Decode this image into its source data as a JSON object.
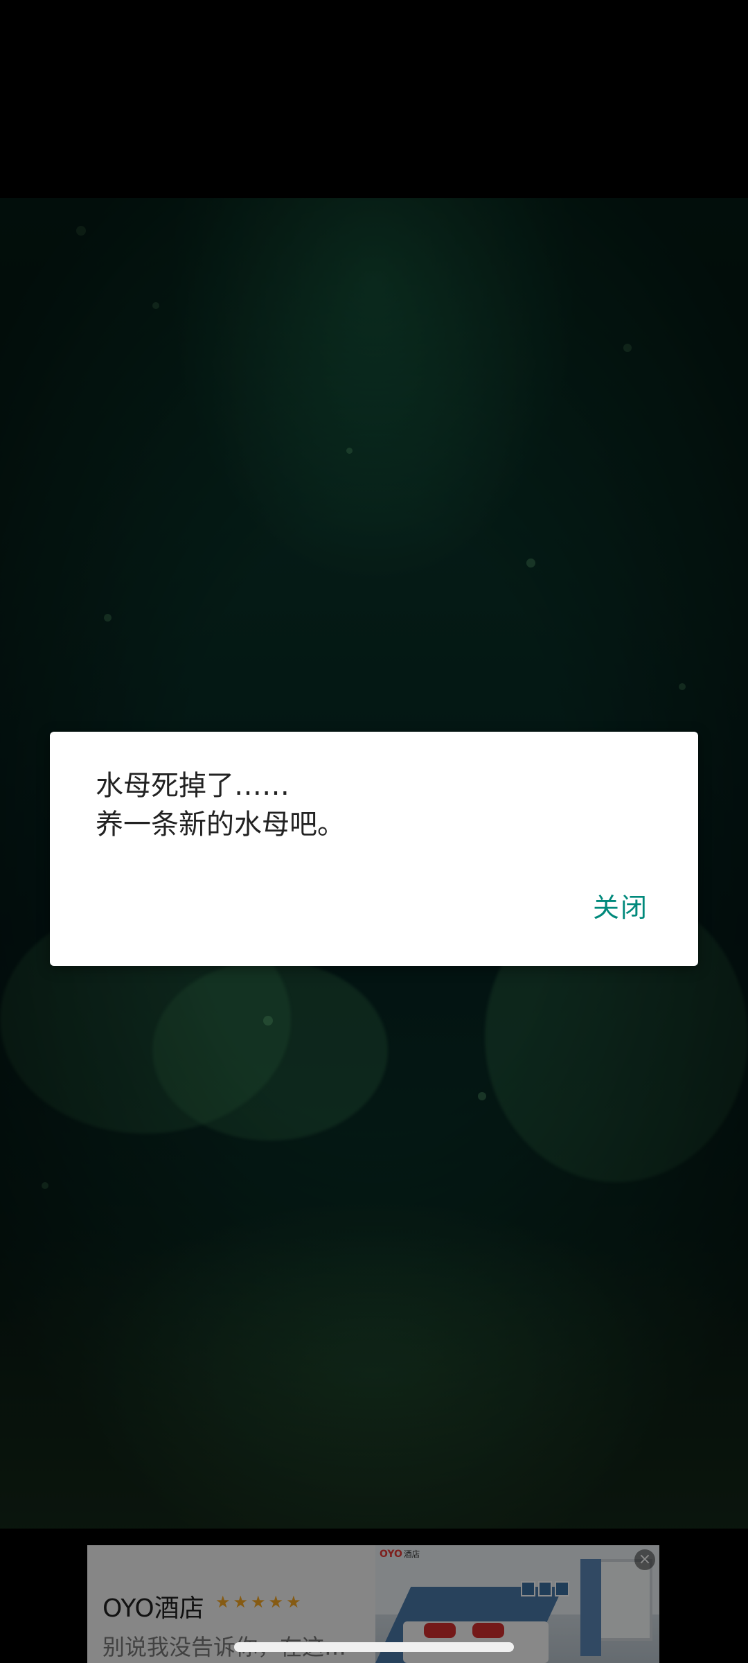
{
  "dialog": {
    "line1": "水母死掉了……",
    "line2": "养一条新的水母吧。",
    "close_label": "关闭"
  },
  "ad": {
    "title": "OYO酒店",
    "stars": "★★★★★",
    "subtitle": "别说我没告诉你，在这…",
    "brand_logo": "OYO",
    "brand_logo_suffix": "酒店",
    "close_icon": "close-icon",
    "close_glyph": "×"
  },
  "colors": {
    "accent": "#00897b",
    "scene_green": "#0a3a2c"
  }
}
